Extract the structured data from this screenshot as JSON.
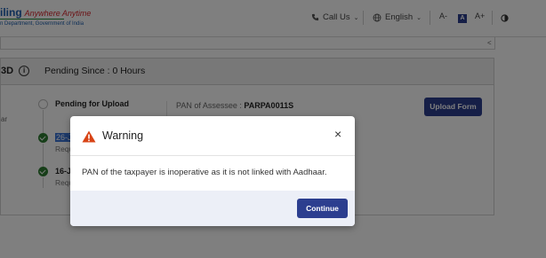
{
  "header": {
    "logo_text": "iling",
    "logo_tagline": "Anywhere Anytime",
    "logo_subtext": "n Department, Government of India",
    "call_us": "Call Us",
    "language": "English",
    "font_decrease": "A-",
    "font_default": "A",
    "font_increase": "A+"
  },
  "top_card": {
    "edge_glyph": "<"
  },
  "panel": {
    "head_fragment": "3D",
    "pending_since": "Pending Since : 0 Hours",
    "steps": [
      {
        "label": "Pending for Upload",
        "status": "pending"
      },
      {
        "label": "26-J",
        "sub": "Requ",
        "status": "done"
      },
      {
        "label": "16-J",
        "sub": "Requ",
        "status": "done"
      }
    ],
    "left_fragment": "ar",
    "pan_label": "PAN of Assessee :",
    "pan_value": "PARPA0011S",
    "upload_button": "Upload Form"
  },
  "modal": {
    "icon": "warning-icon",
    "title": "Warning",
    "message": "PAN of the taxpayer is inoperative as it is not linked with Aadhaar.",
    "close_glyph": "×",
    "continue_button": "Continue"
  },
  "colors": {
    "primary": "#2c3e8f",
    "success": "#2e7d32",
    "warning": "#d84315",
    "overlay": "rgba(0,0,0,0.5)"
  }
}
